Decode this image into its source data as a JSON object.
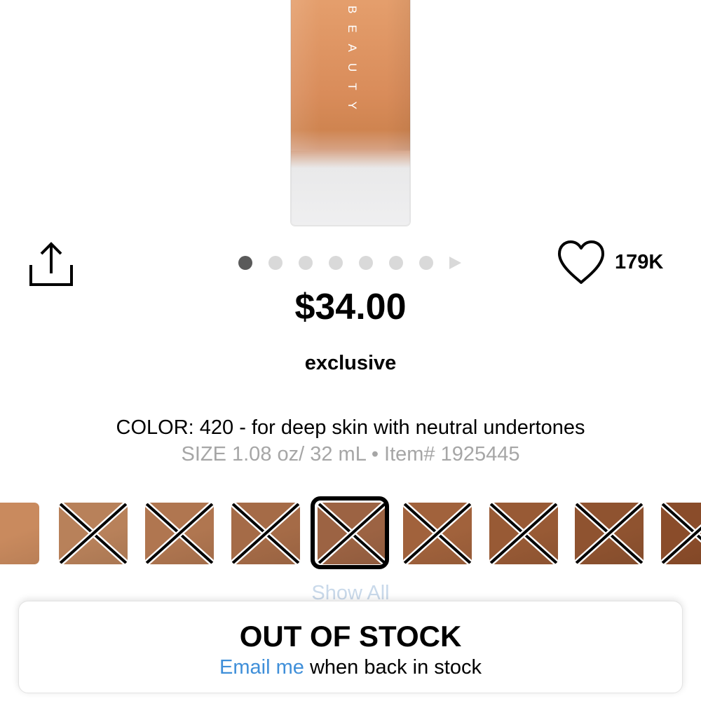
{
  "product": {
    "brand_vertical": "BEAUTY",
    "price": "$34.00",
    "badge": "exclusive",
    "color_line": "COLOR: 420 - for deep skin with neutral undertones",
    "meta_line": "SIZE 1.08 oz/ 32 mL • Item# 1925445"
  },
  "actions": {
    "love_count": "179K",
    "share_icon": "share-icon",
    "love_icon": "heart-outline-icon"
  },
  "carousel": {
    "total_dots": 7,
    "active_index": 0
  },
  "swatches": {
    "show_all_label": "Show All",
    "colors": [
      "#c98a5e",
      "#b8815a",
      "#b07650",
      "#a56b47",
      "#9c6343",
      "#a1623c",
      "#985a35",
      "#8f5330",
      "#8a4c2a"
    ],
    "selected_index": 4
  },
  "stock": {
    "title": "OUT OF STOCK",
    "email_link": "Email me",
    "email_rest": " when back in stock"
  },
  "colors": {
    "link": "#3f8fd9",
    "muted": "#a6a6a6"
  }
}
